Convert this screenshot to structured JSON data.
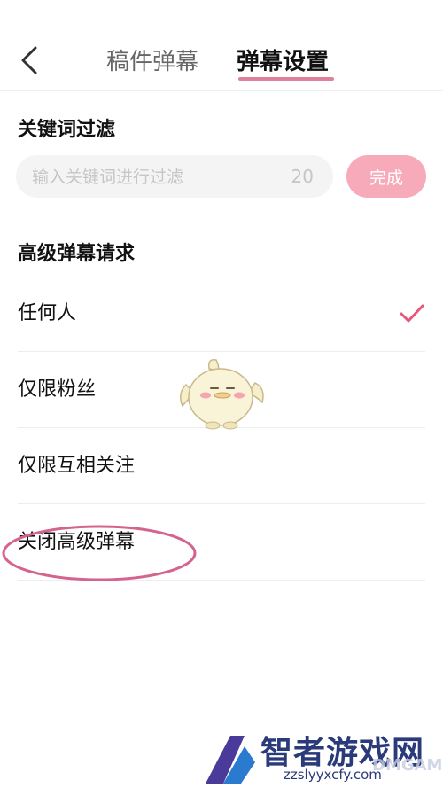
{
  "header": {
    "tabs": [
      {
        "label": "稿件弹幕",
        "active": false
      },
      {
        "label": "弹幕设置",
        "active": true
      }
    ]
  },
  "keyword_filter": {
    "title": "关键词过滤",
    "input_value": "",
    "input_placeholder": "输入关键词进行过滤",
    "remaining_count": "20",
    "done_label": "完成"
  },
  "advanced": {
    "title": "高级弹幕请求",
    "options": [
      {
        "label": "任何人",
        "selected": true
      },
      {
        "label": "仅限粉丝",
        "selected": false
      },
      {
        "label": "仅限互相关注",
        "selected": false
      },
      {
        "label": "关闭高级弹幕",
        "selected": false
      }
    ]
  },
  "colors": {
    "accent": "#e8567a",
    "done_button": "#f7aab9",
    "annotation": "#d4648f"
  },
  "icons": {
    "back": "chevron-left-icon",
    "check": "checkmark-icon"
  },
  "watermark": {
    "title": "智者游戏网",
    "game_text": "DMGAME",
    "url": "zzslyyxcfy.com"
  }
}
